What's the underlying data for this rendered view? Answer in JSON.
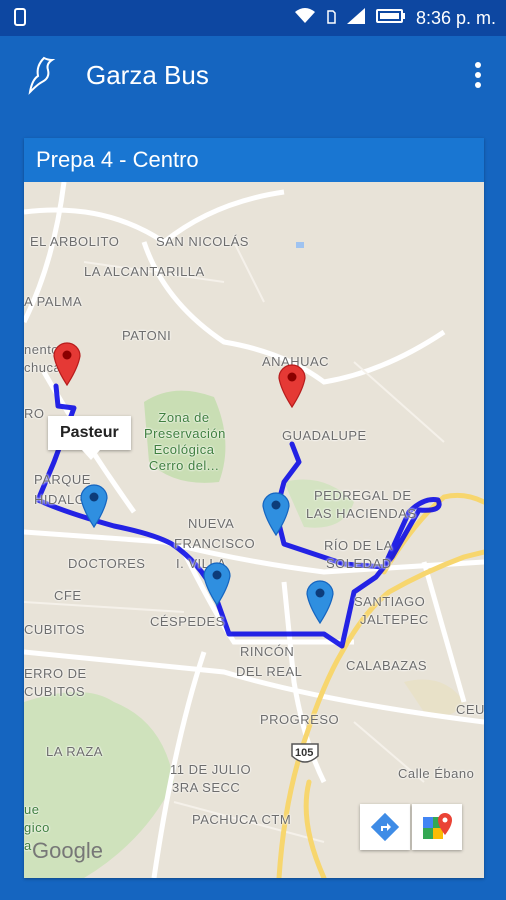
{
  "status": {
    "time": "8:36 p. m."
  },
  "appbar": {
    "title": "Garza Bus"
  },
  "route": {
    "title": "Prepa 4 - Centro"
  },
  "map": {
    "tooltip": "Pasteur",
    "attribution": "Google",
    "shield": "105",
    "labels": {
      "arbolito": "EL ARBOLITO",
      "sannicolas": "SAN NICOLÁS",
      "alcantarilla": "LA ALCANTARILLA",
      "palma": "A PALMA",
      "patoni": "PATONI",
      "anahuac": "ANAHUAC",
      "centro_a": "nento",
      "centro_b": "chuca",
      "centro_c": "RO",
      "zona": "Zona de",
      "zona2": "Preservación",
      "zona3": "Ecológica",
      "zona4": "Cerro del...",
      "guadalupe": "GUADALUPE",
      "parque": "PARQUE",
      "hidalgo": "HIDALGO",
      "pedregal": "PEDREGAL DE",
      "haciendas": "LAS HACIENDAS",
      "nueva": "NUEVA",
      "francisco": "FRANCISCO",
      "ivillarreal": "I. VILLA",
      "rio": "RÍO DE LA",
      "soledad": "SOLEDAD",
      "doctores": "DOCTORES",
      "cfe": "CFE",
      "santiago": "SANTIAGO",
      "jaltepec": "JALTEPEC",
      "cubitos": "CUBITOS",
      "cespedes": "CÉSPEDES",
      "rincon": "RINCÓN",
      "delreal": "DEL REAL",
      "calabazas": "CALABAZAS",
      "cerro": "ERRO DE",
      "cubitos2": "CUBITOS",
      "ceu": "CEU",
      "progreso": "PROGRESO",
      "laraza": "LA RAZA",
      "julio": "11 DE JULIO",
      "secc": "3RA SECC",
      "ebano": "Calle Ébano",
      "pachuca": "PACHUCA CTM",
      "ue": "ue",
      "gico": "gico",
      "a": "a"
    }
  },
  "icons": {
    "logo": "garza-bird-icon",
    "menu": "more-vert-icon",
    "directions": "directions-icon",
    "maps": "google-maps-icon"
  }
}
